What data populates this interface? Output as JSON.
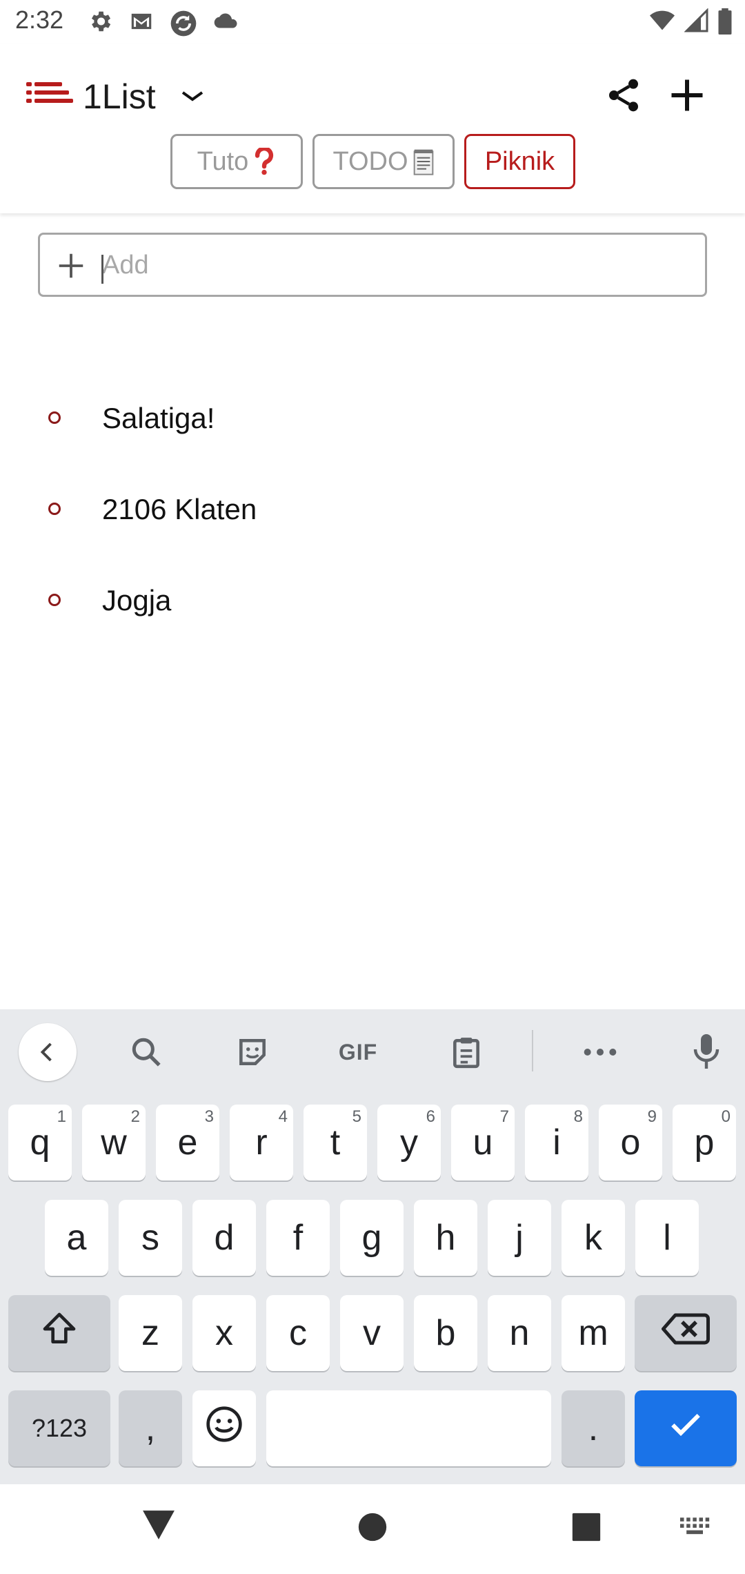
{
  "status_bar": {
    "time": "2:32",
    "left_icons": [
      "settings-icon",
      "gmail-icon",
      "sync-app-icon",
      "cloud-icon"
    ],
    "right_icons": [
      "wifi-icon",
      "cell-signal-icon",
      "battery-icon"
    ]
  },
  "header": {
    "title": "1List",
    "accent_color": "#b71c1c",
    "icons": [
      "list-logo-icon",
      "chevron-down-icon",
      "share-icon",
      "add-icon"
    ]
  },
  "tabs": [
    {
      "label": "Tuto",
      "emoji": "question-icon",
      "active": false
    },
    {
      "label": "TODO",
      "emoji": "notepad-icon",
      "active": false
    },
    {
      "label": "Piknik",
      "active": true
    }
  ],
  "add_field": {
    "placeholder": "Add",
    "value": ""
  },
  "items": [
    {
      "text": "Salatiga!"
    },
    {
      "text": "2106 Klaten"
    },
    {
      "text": "Jogja"
    }
  ],
  "keyboard": {
    "toolbar": {
      "gif_label": "GIF",
      "icons": [
        "back-icon",
        "search-icon",
        "sticker-icon",
        "gif-icon",
        "clipboard-icon",
        "more-icon",
        "mic-icon"
      ]
    },
    "row1": [
      {
        "k": "q",
        "n": "1"
      },
      {
        "k": "w",
        "n": "2"
      },
      {
        "k": "e",
        "n": "3"
      },
      {
        "k": "r",
        "n": "4"
      },
      {
        "k": "t",
        "n": "5"
      },
      {
        "k": "y",
        "n": "6"
      },
      {
        "k": "u",
        "n": "7"
      },
      {
        "k": "i",
        "n": "8"
      },
      {
        "k": "o",
        "n": "9"
      },
      {
        "k": "p",
        "n": "0"
      }
    ],
    "row2": [
      "a",
      "s",
      "d",
      "f",
      "g",
      "h",
      "j",
      "k",
      "l"
    ],
    "row3": [
      "z",
      "x",
      "c",
      "v",
      "b",
      "n",
      "m"
    ],
    "row4": {
      "symbols": "?123",
      "comma": ",",
      "period": "."
    },
    "enter_color": "#1a73e8"
  },
  "nav_bar": {
    "icons": [
      "back-triangle-icon",
      "home-circle-icon",
      "recents-square-icon",
      "keyboard-switch-icon"
    ]
  }
}
